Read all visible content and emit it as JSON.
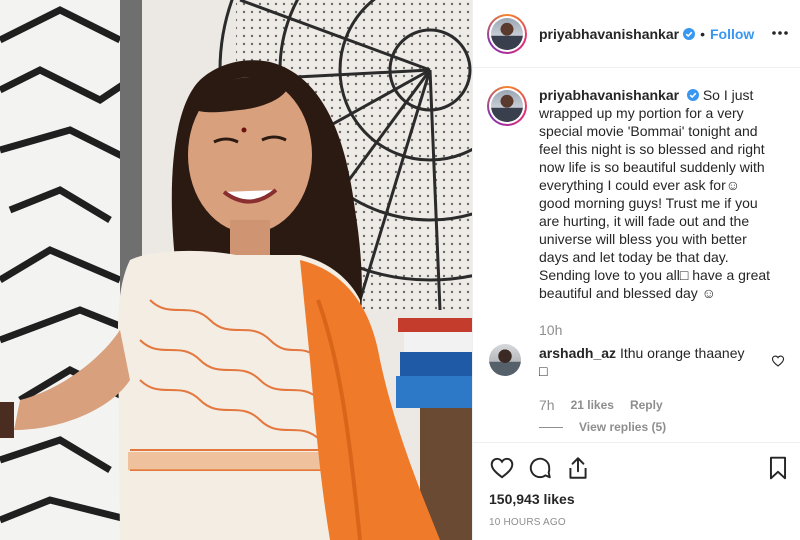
{
  "post": {
    "username": "priyabhavanishankar",
    "dot": "•",
    "follow_label": "Follow",
    "caption_text": "So I just wrapped up my portion for a very special movie 'Bommai' tonight and feel this night is so blessed and right now life is so beautiful suddenly with everything I could ever ask for☺ good morning guys! Trust me if you are hurting, it will fade out and the universe will bless you with better days and let today be that day. Sending love to you all□ have a great beautiful and blessed day ☺",
    "caption_age": "10h",
    "likes": "150,943 likes",
    "posted": "10 HOURS AGO"
  },
  "comment": {
    "username": "arshadh_az",
    "text": "Ithu orange thaaney □",
    "time": "7h",
    "likes": "21 likes",
    "reply_label": "Reply",
    "view_replies": "View replies (5)"
  },
  "icons": {
    "verified": "verified-badge-icon",
    "more": "more-options-icon",
    "heart": "heart-icon",
    "comment": "comment-icon",
    "share": "share-icon",
    "save": "bookmark-icon"
  },
  "colors": {
    "link": "#3897f0",
    "verified": "#3897f0",
    "muted": "#8e8e8e",
    "text": "#262626",
    "dupatta": "#ee7a2a"
  }
}
